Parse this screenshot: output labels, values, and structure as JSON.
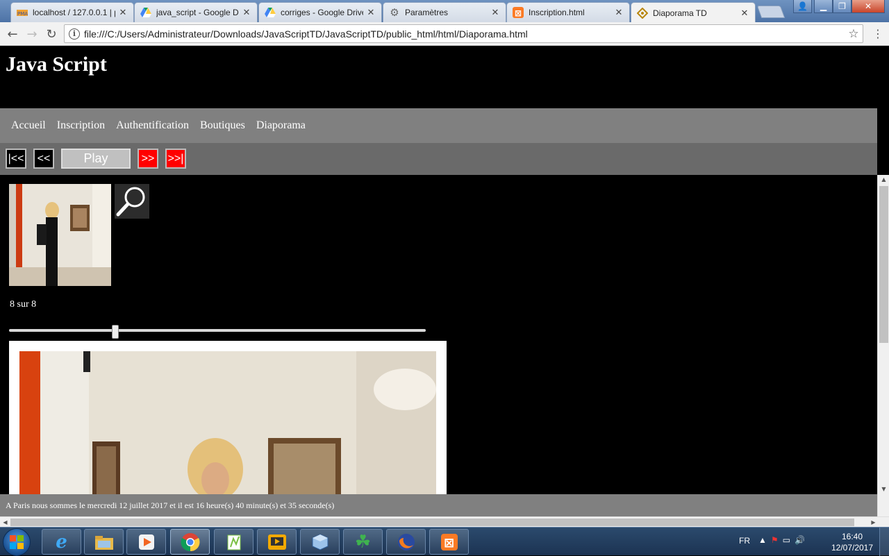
{
  "browser": {
    "tabs": [
      {
        "title": "localhost / 127.0.0.1 | p",
        "icon": "phpmyadmin-icon"
      },
      {
        "title": "java_script - Google Dr",
        "icon": "google-drive-icon"
      },
      {
        "title": "corriges - Google Drive",
        "icon": "google-drive-icon"
      },
      {
        "title": "Paramètres",
        "icon": "gear-icon"
      },
      {
        "title": "Inscription.html",
        "icon": "xampp-icon"
      },
      {
        "title": "Diaporama TD",
        "icon": "diaporama-icon"
      }
    ],
    "url": "file:///C:/Users/Administrateur/Downloads/JavaScriptTD/JavaScriptTD/public_html/html/Diaporama.html"
  },
  "site": {
    "title": "Java Script",
    "nav": [
      "Accueil",
      "Inscription",
      "Authentification",
      "Boutiques",
      "Diaporama"
    ]
  },
  "controls": {
    "first": "|<<",
    "prev": "<<",
    "play": "Play",
    "next": ">>",
    "last": ">>|"
  },
  "slideshow": {
    "counter": "8 sur 8",
    "slider_fraction": 0.25
  },
  "footer": {
    "clock_text": "A Paris nous sommes le mercredi 12 juillet 2017 et il est 16 heure(s) 40 minute(s) et 35 seconde(s)"
  },
  "taskbar": {
    "apps": [
      "internet-explorer-icon",
      "file-explorer-icon",
      "media-player-icon",
      "chrome-icon",
      "notepad-plus-plus-icon",
      "video-player-icon",
      "virtualbox-icon",
      "clover-icon",
      "firefox-icon",
      "xampp-icon"
    ],
    "lang": "FR",
    "time": "16:40",
    "date": "12/07/2017"
  }
}
